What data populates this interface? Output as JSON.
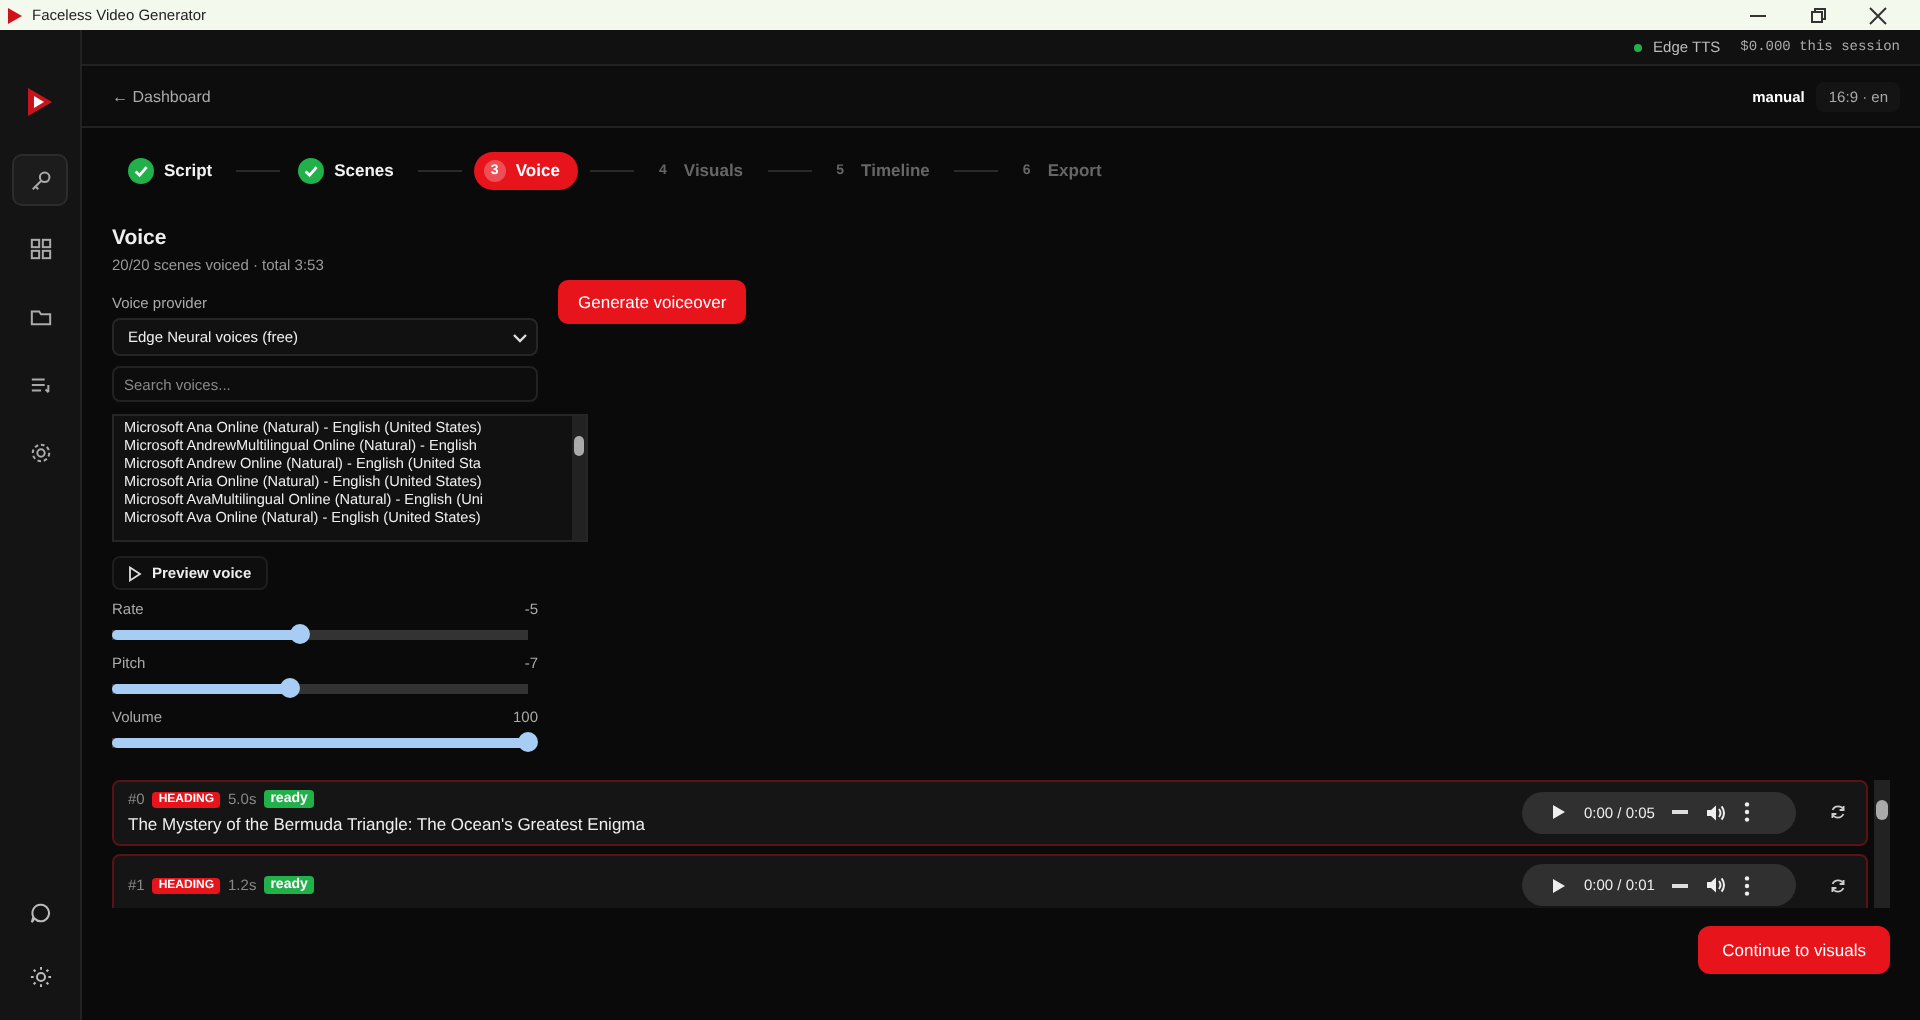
{
  "window": {
    "title": "Faceless Video Generator"
  },
  "sidebar": {
    "items": [
      {
        "kind": "key",
        "selected": true
      },
      {
        "kind": "grid",
        "selected": false
      },
      {
        "kind": "folder",
        "selected": false
      },
      {
        "kind": "list",
        "selected": false
      },
      {
        "kind": "gear",
        "selected": false
      }
    ],
    "bottom": [
      {
        "kind": "chat",
        "selected": false
      },
      {
        "kind": "sun",
        "selected": false
      }
    ]
  },
  "status_bar": {
    "provider": "Edge TTS",
    "provider_online": true,
    "cost": "$0.000 this session"
  },
  "header": {
    "back": "← Dashboard",
    "mode": "manual",
    "format": "16:9 · en"
  },
  "steps": [
    {
      "label": "Script",
      "done": true,
      "selected": false
    },
    {
      "label": "Scenes",
      "done": true,
      "selected": false
    },
    {
      "number": "3",
      "label": "Voice",
      "done": false,
      "selected": true
    },
    {
      "number": "4",
      "label": "Visuals",
      "done": false,
      "selected": false
    },
    {
      "number": "5",
      "label": "Timeline",
      "done": false,
      "selected": false
    },
    {
      "number": "6",
      "label": "Export",
      "done": false,
      "selected": false
    }
  ],
  "voice": {
    "title": "Voice",
    "summary": "20/20 scenes voiced · total 3:53",
    "provider_label": "Voice provider",
    "provider": "Edge Neural voices (free)",
    "search": {
      "placeholder": "Search voices..."
    },
    "voices": [
      "Microsoft Ana Online (Natural) - English (United States)",
      "Microsoft AndrewMultilingual Online (Natural) - English",
      "Microsoft Andrew Online (Natural) - English (United Sta",
      "Microsoft Aria Online (Natural) - English (United States)",
      "Microsoft AvaMultilingual Online (Natural) - English (Uni",
      "Microsoft Ava Online (Natural) - English (United States)"
    ],
    "preview": "Preview voice",
    "generate": "Generate voiceover",
    "sliders": [
      {
        "label": "Rate",
        "reading": "-5",
        "level": 0.45
      },
      {
        "label": "Pitch",
        "reading": "-7",
        "level": 0.43
      },
      {
        "label": "Volume",
        "reading": "100",
        "level": 1
      }
    ]
  },
  "scenes": [
    {
      "index": "#0",
      "tag": "HEADING",
      "duration": "5.0s",
      "status": "ready",
      "text": "The Mystery of the Bermuda Triangle: The Ocean's Greatest Enigma",
      "time": "0:00 / 0:05"
    },
    {
      "index": "#1",
      "tag": "HEADING",
      "duration": "1.2s",
      "status": "ready",
      "time": "0:00 / 0:01"
    }
  ],
  "continue": "Continue to visuals"
}
